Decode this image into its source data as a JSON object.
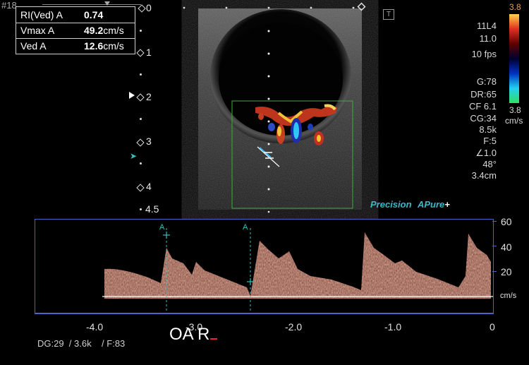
{
  "header": {
    "frame_hash": "#",
    "frame_number": "18"
  },
  "measurements": [
    {
      "label": "RI(Ved) A",
      "value": "0.74",
      "unit": ""
    },
    {
      "label": "Vmax A",
      "value": "49.2",
      "unit": "cm/s"
    },
    {
      "label": "Ved A",
      "value": "12.6",
      "unit": "cm/s"
    }
  ],
  "depth_scale": {
    "labels": [
      "0",
      "1",
      "2",
      "3",
      "4",
      "4.5"
    ]
  },
  "color_bar": {
    "top_value": "3.8",
    "bottom_value": "3.8",
    "unit": "cm/s",
    "colors": [
      "#ffd34a",
      "#e03020",
      "#600000",
      "#000030",
      "#0030c0",
      "#20d0f0",
      "#30e060"
    ]
  },
  "parameters": {
    "probe": "11L4",
    "freq": "11.0",
    "fps": "10 fps",
    "gain": "G:78",
    "dynamic_range": "DR:65",
    "cf": "CF 6.1",
    "cg": "CG:34",
    "prf": "8.5k",
    "filter": "F:5",
    "angle_corr": "∠1.0",
    "angle": "48°",
    "gate": "3.4cm"
  },
  "branding": {
    "precision": "Precision",
    "apure": "APure",
    "apure_plus": "+"
  },
  "doppler": {
    "velocity_labels": [
      "60",
      "40",
      "20",
      "cm/s"
    ],
    "time_labels": [
      "-4.0",
      "-3.0",
      "-2.0",
      "-1.0",
      "0"
    ],
    "marker_label": "A",
    "gain_info": "DG:29  / 3.6k    / F:83"
  },
  "probe_orientation": {
    "text": "OA R"
  },
  "colors": {
    "spectrum": "#e8826a",
    "box_border": "#4a63c9",
    "roi_border": "#3fae3f",
    "marker": "#35c0c0",
    "brand": "#3ab8c8"
  }
}
